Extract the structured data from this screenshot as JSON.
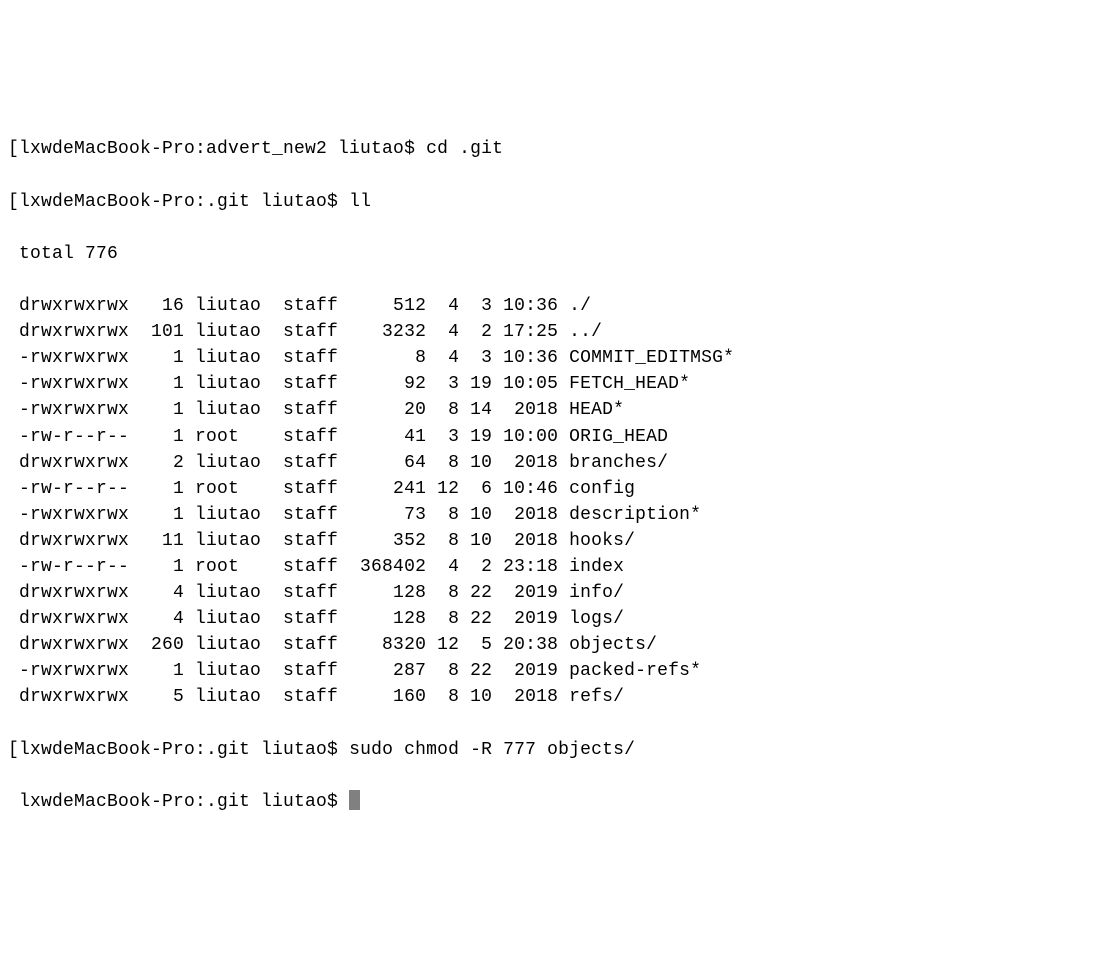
{
  "prompt1": {
    "text": "[lxwdeMacBook-Pro:advert_new2 liutao$ ",
    "command": "cd .git"
  },
  "prompt2": {
    "text": "[lxwdeMacBook-Pro:.git liutao$ ",
    "command": "ll"
  },
  "total_line": " total 776",
  "listing": [
    {
      "perm": " drwxrwxrwx",
      "links": "  16",
      "user": "liutao",
      "group": "staff",
      "size": "   512",
      "month": " 4",
      "day": " 3",
      "time": "10:36",
      "name": "./"
    },
    {
      "perm": " drwxrwxrwx",
      "links": " 101",
      "user": "liutao",
      "group": "staff",
      "size": "  3232",
      "month": " 4",
      "day": " 2",
      "time": "17:25",
      "name": "../"
    },
    {
      "perm": " -rwxrwxrwx",
      "links": "   1",
      "user": "liutao",
      "group": "staff",
      "size": "     8",
      "month": " 4",
      "day": " 3",
      "time": "10:36",
      "name": "COMMIT_EDITMSG*"
    },
    {
      "perm": " -rwxrwxrwx",
      "links": "   1",
      "user": "liutao",
      "group": "staff",
      "size": "    92",
      "month": " 3",
      "day": "19",
      "time": "10:05",
      "name": "FETCH_HEAD*"
    },
    {
      "perm": " -rwxrwxrwx",
      "links": "   1",
      "user": "liutao",
      "group": "staff",
      "size": "    20",
      "month": " 8",
      "day": "14",
      "time": " 2018",
      "name": "HEAD*"
    },
    {
      "perm": " -rw-r--r--",
      "links": "   1",
      "user": "root  ",
      "group": "staff",
      "size": "    41",
      "month": " 3",
      "day": "19",
      "time": "10:00",
      "name": "ORIG_HEAD"
    },
    {
      "perm": " drwxrwxrwx",
      "links": "   2",
      "user": "liutao",
      "group": "staff",
      "size": "    64",
      "month": " 8",
      "day": "10",
      "time": " 2018",
      "name": "branches/"
    },
    {
      "perm": " -rw-r--r--",
      "links": "   1",
      "user": "root  ",
      "group": "staff",
      "size": "   241",
      "month": "12",
      "day": " 6",
      "time": "10:46",
      "name": "config"
    },
    {
      "perm": " -rwxrwxrwx",
      "links": "   1",
      "user": "liutao",
      "group": "staff",
      "size": "    73",
      "month": " 8",
      "day": "10",
      "time": " 2018",
      "name": "description*"
    },
    {
      "perm": " drwxrwxrwx",
      "links": "  11",
      "user": "liutao",
      "group": "staff",
      "size": "   352",
      "month": " 8",
      "day": "10",
      "time": " 2018",
      "name": "hooks/"
    },
    {
      "perm": " -rw-r--r--",
      "links": "   1",
      "user": "root  ",
      "group": "staff",
      "size": "368402",
      "month": " 4",
      "day": " 2",
      "time": "23:18",
      "name": "index"
    },
    {
      "perm": " drwxrwxrwx",
      "links": "   4",
      "user": "liutao",
      "group": "staff",
      "size": "   128",
      "month": " 8",
      "day": "22",
      "time": " 2019",
      "name": "info/"
    },
    {
      "perm": " drwxrwxrwx",
      "links": "   4",
      "user": "liutao",
      "group": "staff",
      "size": "   128",
      "month": " 8",
      "day": "22",
      "time": " 2019",
      "name": "logs/"
    },
    {
      "perm": " drwxrwxrwx",
      "links": " 260",
      "user": "liutao",
      "group": "staff",
      "size": "  8320",
      "month": "12",
      "day": " 5",
      "time": "20:38",
      "name": "objects/"
    },
    {
      "perm": " -rwxrwxrwx",
      "links": "   1",
      "user": "liutao",
      "group": "staff",
      "size": "   287",
      "month": " 8",
      "day": "22",
      "time": " 2019",
      "name": "packed-refs*"
    },
    {
      "perm": " drwxrwxrwx",
      "links": "   5",
      "user": "liutao",
      "group": "staff",
      "size": "   160",
      "month": " 8",
      "day": "10",
      "time": " 2018",
      "name": "refs/"
    }
  ],
  "prompt3": {
    "text": "[lxwdeMacBook-Pro:.git liutao$ ",
    "command": "sudo chmod -R 777 objects/"
  },
  "prompt4": {
    "text": " lxwdeMacBook-Pro:.git liutao$ "
  }
}
